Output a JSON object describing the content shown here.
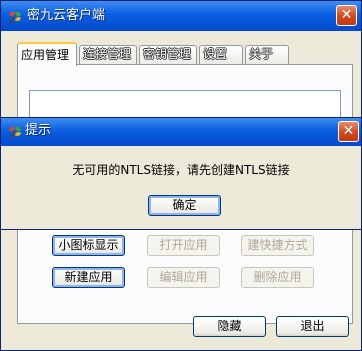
{
  "main_window": {
    "title": "密九云客户端",
    "tabs": [
      "应用管理",
      "连接管理",
      "密钥管理",
      "设置",
      "关于"
    ],
    "active_tab": 0,
    "buttons": {
      "small_icons": "小图标显示",
      "open_app": "打开应用",
      "create_shortcut": "建快捷方式",
      "new_app": "新建应用",
      "edit_app": "编辑应用",
      "delete_app": "删除应用",
      "hide": "隐藏",
      "exit": "退出"
    }
  },
  "dialog": {
    "title": "提示",
    "message": "无可用的NTLS链接，请先创建NTLS链接",
    "ok_label": "确定"
  },
  "icons": {
    "app_icon": "leaf-app-icon",
    "close": "close-icon"
  },
  "colors": {
    "titlebar": "#0A5FE0",
    "close_button": "#D0491C",
    "window_bg": "#ECE9D8"
  }
}
